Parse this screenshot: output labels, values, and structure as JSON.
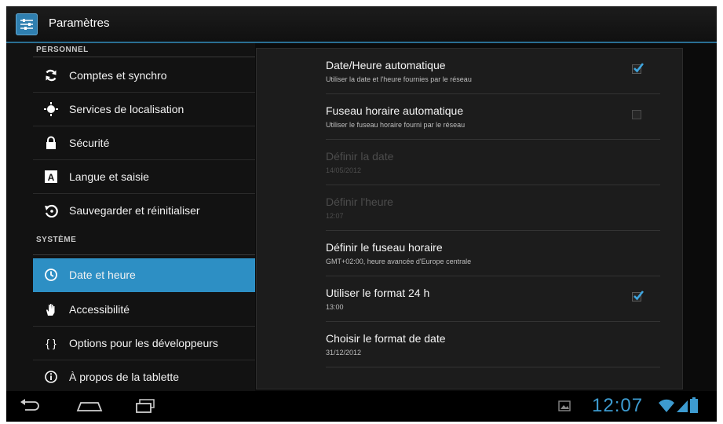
{
  "app_bar": {
    "title": "Paramètres",
    "icon": "settings-app-icon"
  },
  "sidebar": {
    "sections": [
      {
        "header": "PERSONNEL",
        "items": [
          {
            "label": "Comptes et synchro",
            "icon": "sync-icon"
          },
          {
            "label": "Services de localisation",
            "icon": "location-icon"
          },
          {
            "label": "Sécurité",
            "icon": "lock-icon"
          },
          {
            "label": "Langue et saisie",
            "icon": "language-icon"
          },
          {
            "label": "Sauvegarder et réinitialiser",
            "icon": "backup-icon"
          }
        ]
      },
      {
        "header": "SYSTÈME",
        "items": [
          {
            "label": "Date et heure",
            "icon": "clock-icon",
            "selected": true
          },
          {
            "label": "Accessibilité",
            "icon": "hand-icon"
          },
          {
            "label": "Options pour les développeurs",
            "icon": "braces-icon"
          },
          {
            "label": "À propos de la tablette",
            "icon": "info-icon"
          }
        ]
      }
    ]
  },
  "date_time": {
    "items": [
      {
        "title": "Date/Heure automatique",
        "summary": "Utiliser la date et l'heure fournies par le réseau",
        "checkbox": true,
        "checked": true,
        "enabled": true
      },
      {
        "title": "Fuseau horaire automatique",
        "summary": "Utiliser le fuseau horaire fourni par le réseau",
        "checkbox": true,
        "checked": false,
        "enabled": true
      },
      {
        "title": "Définir la date",
        "summary": "14/05/2012",
        "checkbox": false,
        "enabled": false
      },
      {
        "title": "Définir l'heure",
        "summary": "12:07",
        "checkbox": false,
        "enabled": false
      },
      {
        "title": "Définir le fuseau horaire",
        "summary": "GMT+02:00, heure avancée d'Europe centrale",
        "checkbox": false,
        "enabled": true
      },
      {
        "title": "Utiliser le format 24 h",
        "summary": "13:00",
        "checkbox": true,
        "checked": true,
        "enabled": true
      },
      {
        "title": "Choisir le format de date",
        "summary": "31/12/2012",
        "checkbox": false,
        "enabled": true
      }
    ]
  },
  "status_bar": {
    "time": "12:07",
    "icons": [
      "gallery-notification-icon",
      "wifi-icon",
      "signal-icon",
      "battery-icon"
    ]
  },
  "nav_buttons": [
    "back-button",
    "home-button",
    "recents-button"
  ],
  "colors": {
    "accent": "#2d8fc4",
    "clock": "#3d9bd0",
    "background": "#0b0b0b"
  }
}
